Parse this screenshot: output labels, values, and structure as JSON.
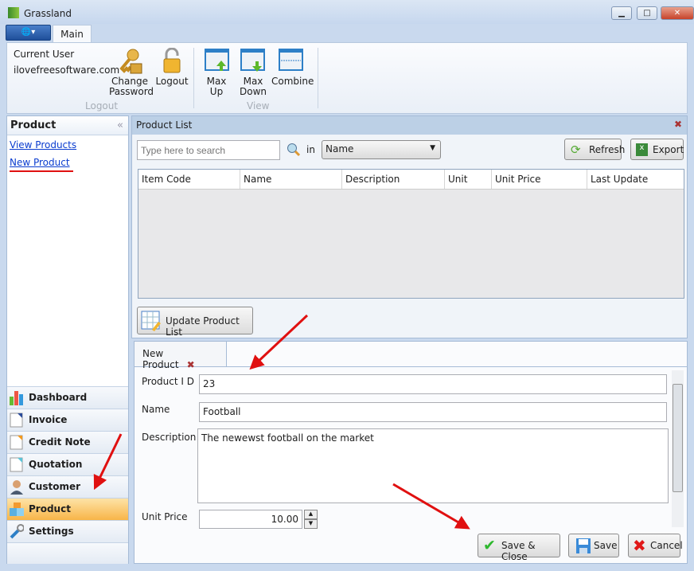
{
  "window": {
    "title": "Grassland",
    "minimize": "▁",
    "maximize": "□",
    "close": "✕"
  },
  "ribbon": {
    "tabs": [
      {
        "label": "Main"
      }
    ],
    "current_user_label": "Current User",
    "current_user": "ilovefreesoftware.com",
    "logout_group": {
      "label": "Logout",
      "buttons": [
        {
          "label": "Change Password",
          "icon": "key-lock-icon"
        },
        {
          "label": "Logout",
          "icon": "padlock-icon"
        }
      ]
    },
    "view_group": {
      "label": "View",
      "buttons": [
        {
          "label": "Max Up",
          "icon": "max-up-icon"
        },
        {
          "label": "Max Down",
          "icon": "max-down-icon"
        },
        {
          "label": "Combine",
          "icon": "combine-icon"
        }
      ]
    }
  },
  "sidebar": {
    "title": "Product",
    "collapse": "«",
    "links": [
      {
        "label": "View Products"
      },
      {
        "label": "New Product"
      }
    ],
    "nav": [
      {
        "label": "Dashboard"
      },
      {
        "label": "Invoice"
      },
      {
        "label": "Credit Note"
      },
      {
        "label": "Quotation"
      },
      {
        "label": "Customer"
      },
      {
        "label": "Product",
        "active": true
      },
      {
        "label": "Settings"
      }
    ]
  },
  "product_list": {
    "title": "Product List",
    "search_placeholder": "Type here to search",
    "in_label": "in",
    "search_field": "Name",
    "refresh": "Refresh",
    "export": "Export",
    "columns": [
      "Item Code",
      "Name",
      "Description",
      "Unit",
      "Unit Price",
      "Last Update"
    ],
    "rows": [],
    "update_button": "Update Product List"
  },
  "new_product": {
    "tab_label": "New Product",
    "fields": {
      "product_id": {
        "label": "Product I D",
        "value": "23"
      },
      "name": {
        "label": "Name",
        "value": "Football"
      },
      "description": {
        "label": "Description",
        "value": "The newewst football on the market"
      },
      "unit_price": {
        "label": "Unit Price",
        "value": "10.00"
      }
    },
    "save_close": "Save & Close",
    "save": "Save",
    "cancel": "Cancel"
  },
  "colors": {
    "accent": "#f8b548",
    "link": "#0a3ccf",
    "annotation": "#e01010"
  }
}
